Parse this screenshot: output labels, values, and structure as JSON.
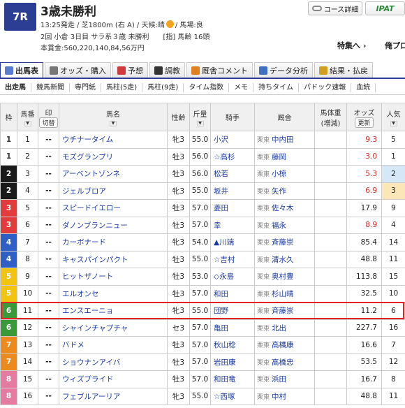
{
  "race": {
    "number": "7R",
    "title": "3歳未勝利",
    "info_line1_a": "13:25発走 / 芝1800m (右 A) / 天候:晴",
    "info_line1_b": "/ 馬場:良",
    "info_line2": "2回 小倉 3日目 サラ系３歳 未勝利　　[指] 馬齢 16頭",
    "info_line3": "本賞金:560,220,140,84,56万円"
  },
  "header_buttons": {
    "course": "コース詳細",
    "ipat": "IPAT"
  },
  "links": {
    "tokushu": "特集へ ›",
    "ore": "俺プロ"
  },
  "tabs": [
    {
      "label": "出馬表",
      "color": "#5a7bd0"
    },
    {
      "label": "オッズ・購入",
      "color": "#777"
    },
    {
      "label": "予想",
      "color": "#d03a3a"
    },
    {
      "label": "調教",
      "color": "#333"
    },
    {
      "label": "厩舎コメント",
      "color": "#e08020"
    },
    {
      "label": "データ分析",
      "color": "#4070c0"
    },
    {
      "label": "結果・払戻",
      "color": "#d0a020"
    }
  ],
  "subtabs": [
    "出走馬",
    "競馬新聞",
    "専門紙",
    "馬柱(5走)",
    "馬柱(9走)",
    "タイム指数",
    "メモ",
    "持ちタイム",
    "パドック速報",
    "血統"
  ],
  "columns": {
    "waku": "枠",
    "umaban": "馬番",
    "mark": "印",
    "mark_sub": "切替",
    "name": "馬名",
    "sex_age": "性齢",
    "weight": "斤量",
    "jockey": "騎手",
    "trainer": "厩舎",
    "body_weight": "馬体重",
    "body_weight_sub": "(増減)",
    "odds": "オッズ",
    "odds_update": "更新",
    "popularity": "人気"
  },
  "mark_placeholder": "--",
  "rows": [
    {
      "waku": "1",
      "umaban": "1",
      "name": "ウチナータイム",
      "sex_age": "牝3",
      "weight": "55.0",
      "jockey": "小沢",
      "belong": "栗東",
      "trainer": "中内田",
      "odds": "9.3",
      "pop": "5",
      "waku_bg": "#ffffff",
      "waku_fg": "#333333",
      "odds_color": "#d03030",
      "pop_bg": "#ffffff"
    },
    {
      "waku": "1",
      "umaban": "2",
      "name": "モズグランプリ",
      "sex_age": "牡3",
      "weight": "56.0",
      "jockey": "☆高杉",
      "belong": "栗東",
      "trainer": "藤岡",
      "odds": "3.0",
      "pop": "1",
      "waku_bg": "#ffffff",
      "waku_fg": "#333333",
      "odds_color": "#d03030",
      "pop_bg": "#ffffff"
    },
    {
      "waku": "2",
      "umaban": "3",
      "name": "アーベントゾンネ",
      "sex_age": "牡3",
      "weight": "56.0",
      "jockey": "松若",
      "belong": "栗東",
      "trainer": "小椋",
      "odds": "5.3",
      "pop": "2",
      "waku_bg": "#1a1a1a",
      "waku_fg": "#ffffff",
      "odds_color": "#d03030",
      "pop_bg": "#d6e8f8"
    },
    {
      "waku": "2",
      "umaban": "4",
      "name": "ジェルブロア",
      "sex_age": "牝3",
      "weight": "55.0",
      "jockey": "坂井",
      "belong": "栗東",
      "trainer": "矢作",
      "odds": "6.9",
      "pop": "3",
      "waku_bg": "#1a1a1a",
      "waku_fg": "#ffffff",
      "odds_color": "#d03030",
      "pop_bg": "#fbe6b8"
    },
    {
      "waku": "3",
      "umaban": "5",
      "name": "スピードイエロー",
      "sex_age": "牡3",
      "weight": "57.0",
      "jockey": "菱田",
      "belong": "栗東",
      "trainer": "佐々木",
      "odds": "17.9",
      "pop": "9",
      "waku_bg": "#e23b3b",
      "waku_fg": "#ffffff",
      "odds_color": "#222222",
      "pop_bg": "#ffffff"
    },
    {
      "waku": "3",
      "umaban": "6",
      "name": "ダノンブランニュー",
      "sex_age": "牡3",
      "weight": "57.0",
      "jockey": "幸",
      "belong": "栗東",
      "trainer": "福永",
      "odds": "8.9",
      "pop": "4",
      "waku_bg": "#e23b3b",
      "waku_fg": "#ffffff",
      "odds_color": "#d03030",
      "pop_bg": "#ffffff"
    },
    {
      "waku": "4",
      "umaban": "7",
      "name": "カーボナード",
      "sex_age": "牝3",
      "weight": "54.0",
      "jockey": "▲川端",
      "belong": "栗東",
      "trainer": "斉藤崇",
      "odds": "85.4",
      "pop": "14",
      "waku_bg": "#2f5fc4",
      "waku_fg": "#ffffff",
      "odds_color": "#222222",
      "pop_bg": "#ffffff"
    },
    {
      "waku": "4",
      "umaban": "8",
      "name": "キャスパインパクト",
      "sex_age": "牡3",
      "weight": "55.0",
      "jockey": "☆吉村",
      "belong": "栗東",
      "trainer": "清水久",
      "odds": "48.8",
      "pop": "11",
      "waku_bg": "#2f5fc4",
      "waku_fg": "#ffffff",
      "odds_color": "#222222",
      "pop_bg": "#ffffff"
    },
    {
      "waku": "5",
      "umaban": "9",
      "name": "ヒットザノート",
      "sex_age": "牡3",
      "weight": "53.0",
      "jockey": "◇永島",
      "belong": "栗東",
      "trainer": "奥村豊",
      "odds": "113.8",
      "pop": "15",
      "waku_bg": "#f2c40f",
      "waku_fg": "#ffffff",
      "odds_color": "#222222",
      "pop_bg": "#ffffff"
    },
    {
      "waku": "5",
      "umaban": "10",
      "name": "エルオンセ",
      "sex_age": "牡3",
      "weight": "57.0",
      "jockey": "和田",
      "belong": "栗東",
      "trainer": "杉山晴",
      "odds": "32.5",
      "pop": "10",
      "waku_bg": "#f2c40f",
      "waku_fg": "#ffffff",
      "odds_color": "#222222",
      "pop_bg": "#ffffff"
    },
    {
      "waku": "6",
      "umaban": "11",
      "name": "エンスエーニョ",
      "sex_age": "牝3",
      "weight": "55.0",
      "jockey": "団野",
      "belong": "栗東",
      "trainer": "斉藤崇",
      "odds": "11.2",
      "pop": "6",
      "waku_bg": "#3a9a3a",
      "waku_fg": "#ffffff",
      "odds_color": "#222222",
      "pop_bg": "#ffffff"
    },
    {
      "waku": "6",
      "umaban": "12",
      "name": "シャインチャプチャ",
      "sex_age": "セ3",
      "weight": "57.0",
      "jockey": "亀田",
      "belong": "栗東",
      "trainer": "北出",
      "odds": "227.7",
      "pop": "16",
      "waku_bg": "#3a9a3a",
      "waku_fg": "#ffffff",
      "odds_color": "#222222",
      "pop_bg": "#ffffff"
    },
    {
      "waku": "7",
      "umaban": "13",
      "name": "バドメ",
      "sex_age": "牡3",
      "weight": "57.0",
      "jockey": "秋山稔",
      "belong": "栗東",
      "trainer": "高橋康",
      "odds": "16.6",
      "pop": "7",
      "waku_bg": "#ec8a1e",
      "waku_fg": "#ffffff",
      "odds_color": "#222222",
      "pop_bg": "#ffffff"
    },
    {
      "waku": "7",
      "umaban": "14",
      "name": "ショウナンアイバ",
      "sex_age": "牡3",
      "weight": "57.0",
      "jockey": "岩田康",
      "belong": "栗東",
      "trainer": "高橋忠",
      "odds": "53.5",
      "pop": "12",
      "waku_bg": "#ec8a1e",
      "waku_fg": "#ffffff",
      "odds_color": "#222222",
      "pop_bg": "#ffffff"
    },
    {
      "waku": "8",
      "umaban": "15",
      "name": "ウィズプライド",
      "sex_age": "牡3",
      "weight": "57.0",
      "jockey": "和田竜",
      "belong": "栗東",
      "trainer": "浜田",
      "odds": "16.7",
      "pop": "8",
      "waku_bg": "#e77aa0",
      "waku_fg": "#ffffff",
      "odds_color": "#222222",
      "pop_bg": "#ffffff"
    },
    {
      "waku": "8",
      "umaban": "16",
      "name": "フェブルアーリア",
      "sex_age": "牝3",
      "weight": "55.0",
      "jockey": "☆西塚",
      "belong": "栗東",
      "trainer": "中村",
      "odds": "48.8",
      "pop": "11",
      "waku_bg": "#e77aa0",
      "waku_fg": "#ffffff",
      "odds_color": "#222222",
      "pop_bg": "#ffffff"
    }
  ]
}
